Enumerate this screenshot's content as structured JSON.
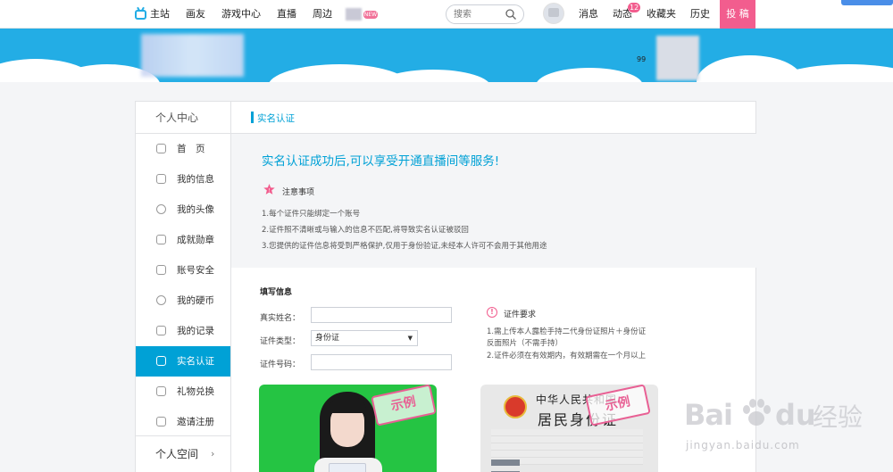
{
  "topnav": {
    "items": [
      "主站",
      "画友",
      "游戏中心",
      "直播",
      "周边"
    ],
    "new_badge": "NEW",
    "search_placeholder": "搜索",
    "right_items": [
      "消息",
      "动态",
      "收藏夹",
      "历史"
    ],
    "dynamic_count": "12",
    "submit_label": "投 稿"
  },
  "banner": {
    "level_text": "99"
  },
  "sidebar": {
    "header": "个人中心",
    "items": [
      {
        "label": "首　页",
        "icon": "home-icon"
      },
      {
        "label": "我的信息",
        "icon": "profile-icon"
      },
      {
        "label": "我的头像",
        "icon": "face-icon"
      },
      {
        "label": "成就勋章",
        "icon": "medal-icon"
      },
      {
        "label": "账号安全",
        "icon": "shield-icon"
      },
      {
        "label": "我的硬币",
        "icon": "coin-icon"
      },
      {
        "label": "我的记录",
        "icon": "record-icon"
      },
      {
        "label": "实名认证",
        "icon": "idcard-icon"
      },
      {
        "label": "礼物兑换",
        "icon": "gift-icon"
      },
      {
        "label": "邀请注册",
        "icon": "invite-icon"
      }
    ],
    "active_index": 7,
    "footer": "个人空间",
    "footer_chevron": "›"
  },
  "content": {
    "header_title": "实名认证",
    "notice": {
      "title": "实名认证成功后,可以享受开通直播间等服务!",
      "label": "注意事项",
      "lines": [
        "1.每个证件只能绑定一个账号",
        "2.证件照不清晰或与输入的信息不匹配,将导致实名认证被驳回",
        "3.您提供的证件信息将受到严格保护,仅用于身份验证,未经本人许可不会用于其他用途"
      ]
    },
    "form": {
      "title": "填写信息",
      "name_label": "真实姓名：",
      "name_value": "",
      "type_label": "证件类型：",
      "type_value": "身份证",
      "number_label": "证件号码：",
      "number_value": ""
    },
    "requirements": {
      "icon_glyph": "!",
      "label": "证件要求",
      "lines": [
        "1.需上传本人露脸手持二代身份证照片＋身份证",
        "反面照片（不需手持）",
        "2.证件必须在有效期内，有效期需在一个月以上"
      ]
    },
    "samples": {
      "stamp": "示例",
      "card_title": "中华人民共和国",
      "card_subtitle": "居民身份证"
    }
  },
  "watermark": {
    "bai": "Bai",
    "du": "du",
    "cn": "经验",
    "url": "jingyan.baidu.com"
  },
  "colors": {
    "accent": "#00a1d6",
    "banner": "#23ade5",
    "pink": "#f25d8e",
    "notice_bg": "#f4f5f7"
  }
}
